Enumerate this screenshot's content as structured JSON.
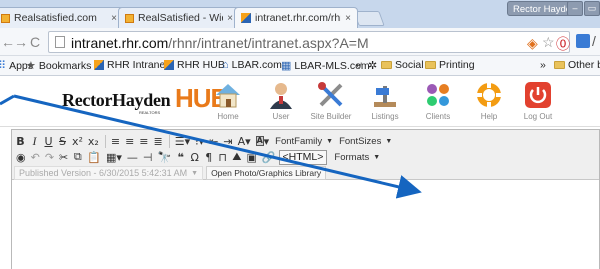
{
  "browser": {
    "tabs": [
      {
        "label": "Realsatisfied.com",
        "close": "×"
      },
      {
        "label": "RealSatisfied - Widget Co",
        "close": "×"
      },
      {
        "label": "intranet.rhr.com/rhnr/intr",
        "close": "×"
      }
    ],
    "profile_label": "Rector Hayden",
    "url_host": "intranet.rhr.com",
    "url_path": "/rhnr/intranet/intranet.aspx?A=M"
  },
  "bookmarks": {
    "items": [
      {
        "label": "Apps"
      },
      {
        "label": "Bookmarks"
      },
      {
        "label": "RHR Intranet"
      },
      {
        "label": "RHR HUB"
      },
      {
        "label": "LBAR.com"
      },
      {
        "label": "LBAR-MLS.com"
      },
      {
        "label": "Social"
      },
      {
        "label": "Printing"
      },
      {
        "label": "Other boo"
      }
    ],
    "overflow": "»"
  },
  "site": {
    "logo_text": "RectorHayden",
    "logo_hub": "HUB",
    "logo_realtors": "REALTORS",
    "nav": [
      {
        "label": "Home",
        "icon": "home-icon"
      },
      {
        "label": "User",
        "icon": "user-icon"
      },
      {
        "label": "Site Builder",
        "icon": "tools-icon"
      },
      {
        "label": "Listings",
        "icon": "listings-icon"
      },
      {
        "label": "Clients",
        "icon": "clients-icon"
      },
      {
        "label": "Help",
        "icon": "lifebuoy-icon"
      },
      {
        "label": "Log Out",
        "icon": "power-icon"
      }
    ]
  },
  "editor": {
    "font_family": "FontFamily",
    "font_sizes": "FontSizes",
    "html_button": "<HTML>",
    "formats": "Formats",
    "published_version": "Published Version - 6/30/2015 5:42:31 AM",
    "open_library": "Open Photo/Graphics Library"
  }
}
